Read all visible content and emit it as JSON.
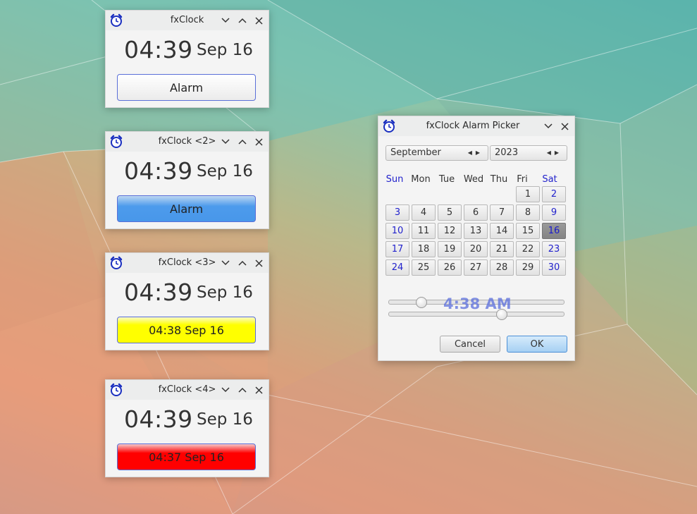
{
  "colors": {
    "accent_blue": "#4897ea",
    "alarm_yellow": "#ffff00",
    "alarm_red": "#ff0000",
    "weekend_text": "#2222cc"
  },
  "clocks": [
    {
      "title": "fxClock",
      "time": "04:39",
      "date": "Sep 16",
      "button": "Alarm",
      "style": "white"
    },
    {
      "title": "fxClock <2>",
      "time": "04:39",
      "date": "Sep 16",
      "button": "Alarm",
      "style": "blue"
    },
    {
      "title": "fxClock <3>",
      "time": "04:39",
      "date": "Sep 16",
      "button": "04:38 Sep 16",
      "style": "yellow"
    },
    {
      "title": "fxClock <4>",
      "time": "04:39",
      "date": "Sep 16",
      "button": "04:37 Sep 16",
      "style": "red"
    }
  ],
  "picker": {
    "title": "fxClock Alarm Picker",
    "month": "September",
    "year": "2023",
    "weekdays": [
      "Sun",
      "Mon",
      "Tue",
      "Wed",
      "Thu",
      "Fri",
      "Sat"
    ],
    "days": [
      "1",
      "2",
      "3",
      "4",
      "5",
      "6",
      "7",
      "8",
      "9",
      "10",
      "11",
      "12",
      "13",
      "14",
      "15",
      "16",
      "17",
      "18",
      "19",
      "20",
      "21",
      "22",
      "23",
      "24",
      "25",
      "26",
      "27",
      "28",
      "29",
      "30"
    ],
    "selected_day": "16",
    "time_label": "4:38 AM",
    "cancel": "Cancel",
    "ok": "OK"
  }
}
